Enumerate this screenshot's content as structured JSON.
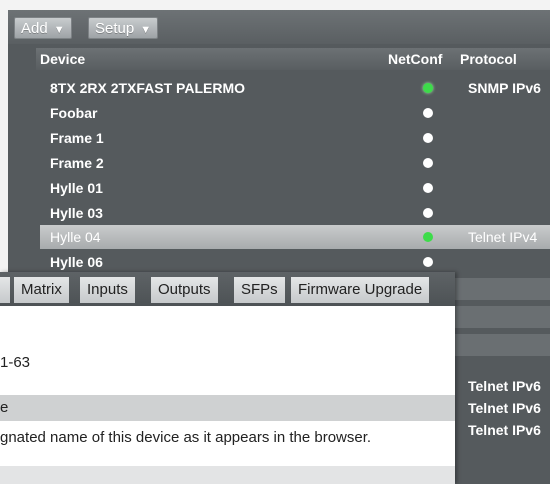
{
  "toolbar": {
    "add_label": "Add",
    "setup_label": "Setup"
  },
  "table": {
    "headers": {
      "device": "Device",
      "netconf": "NetConf",
      "protocol": "Protocol"
    },
    "rows": [
      {
        "name": "8TX 2RX 2TXFAST PALERMO",
        "status": "green",
        "protocol": "SNMP IPv6"
      },
      {
        "name": "Foobar",
        "status": "white",
        "protocol": ""
      },
      {
        "name": "Frame 1",
        "status": "white",
        "protocol": ""
      },
      {
        "name": "Frame 2",
        "status": "white",
        "protocol": ""
      },
      {
        "name": "Hylle 01",
        "status": "white",
        "protocol": ""
      },
      {
        "name": "Hylle 03",
        "status": "white",
        "protocol": ""
      },
      {
        "name": "Hylle 04",
        "status": "green",
        "protocol": "Telnet IPv4",
        "selected": true
      },
      {
        "name": "Hylle 06",
        "status": "white",
        "protocol": ""
      }
    ],
    "partial_protocols": [
      "Telnet IPv6",
      "Telnet IPv6",
      "Telnet IPv6"
    ]
  },
  "overlay": {
    "tabs": [
      "Matrix",
      "Inputs",
      "Outputs",
      "SFPs",
      "Firmware Upgrade"
    ],
    "range_text": "1-63",
    "section_label": "e",
    "description": "gnated name of this device as it appears in the browser."
  },
  "colors": {
    "status_green": "#3ddc4a",
    "status_white": "#ffffff"
  }
}
